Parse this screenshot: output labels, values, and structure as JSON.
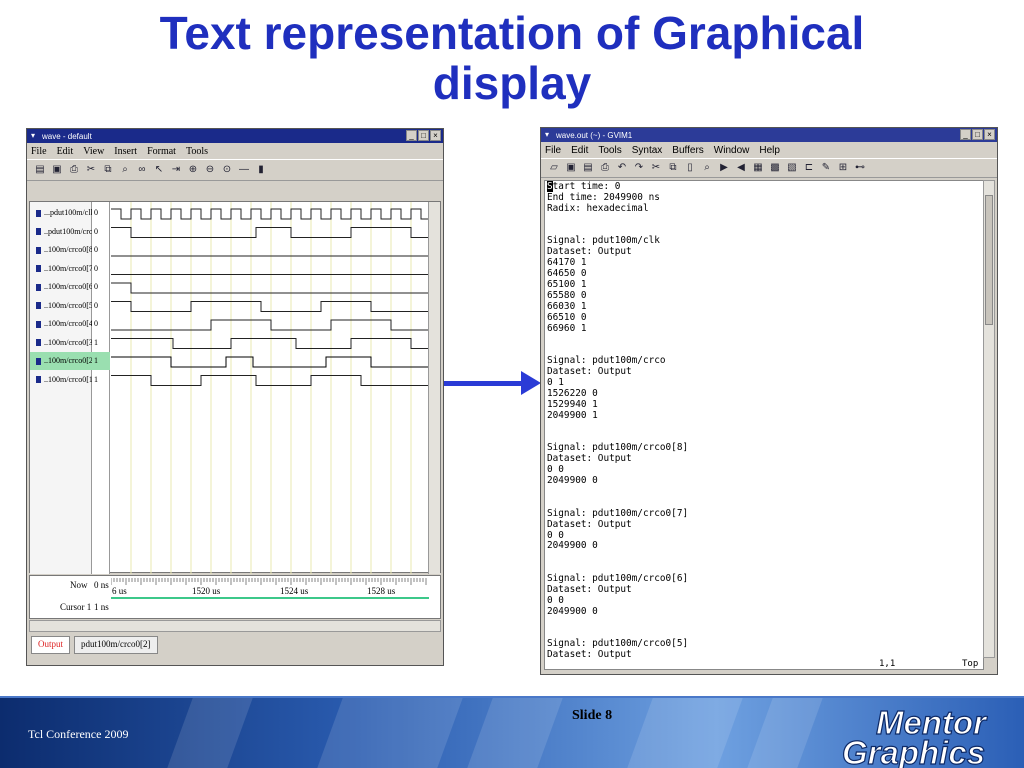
{
  "slide": {
    "title_line1": "Text representation of Graphical",
    "title_line2": "display",
    "footer_left": "Tcl Conference 2009",
    "slide_number": "Slide 8",
    "logo_line1": "Mentor",
    "logo_line2": "Graphics"
  },
  "wave_window": {
    "title": "wave - default",
    "menu": [
      "File",
      "Edit",
      "View",
      "Insert",
      "Format",
      "Tools"
    ],
    "signals": [
      {
        "name": "...pdut100m/clk",
        "value": "0"
      },
      {
        "name": "..pdut100m/crco",
        "value": "0"
      },
      {
        "name": "..100m/crco0[8]",
        "value": "0"
      },
      {
        "name": "..100m/crco0[7]",
        "value": "0"
      },
      {
        "name": "..100m/crco0[6]",
        "value": "0"
      },
      {
        "name": "..100m/crco0[5]",
        "value": "0"
      },
      {
        "name": "..100m/crco0[4]",
        "value": "0"
      },
      {
        "name": "..100m/crco0[3]",
        "value": "1"
      },
      {
        "name": "..100m/crco0[2]",
        "value": "1"
      },
      {
        "name": "..100m/crco0[1]",
        "value": "1"
      }
    ],
    "selected_index": 8,
    "now_label": "Now",
    "now_value": "0 ns",
    "cursor_label": "Cursor 1",
    "cursor_value": "1 ns",
    "timeline_ticks": [
      "6 us",
      "1520 us",
      "1524 us",
      "1528 us"
    ],
    "tabs": [
      "Output",
      "pdut100m/crco0[2]"
    ],
    "active_tab": 0,
    "accent_color": "#3cc88a"
  },
  "gvim_window": {
    "title": "wave.out (~) - GVIM1",
    "menu": [
      "File",
      "Edit",
      "Tools",
      "Syntax",
      "Buffers",
      "Window",
      "Help"
    ],
    "lines": [
      "Start time: 0",
      "End time: 2049900 ns",
      "Radix: hexadecimal",
      "",
      "",
      "Signal: pdut100m/clk",
      "Dataset: Output",
      "64170 1",
      "64650 0",
      "65100 1",
      "65580 0",
      "66030 1",
      "66510 0",
      "66960 1",
      "",
      "",
      "Signal: pdut100m/crco",
      "Dataset: Output",
      "0 1",
      "1526220 0",
      "1529940 1",
      "2049900 1",
      "",
      "",
      "Signal: pdut100m/crco0[8]",
      "Dataset: Output",
      "0 0",
      "2049900 0",
      "",
      "",
      "Signal: pdut100m/crco0[7]",
      "Dataset: Output",
      "0 0",
      "2049900 0",
      "",
      "",
      "Signal: pdut100m/crco0[6]",
      "Dataset: Output",
      "0 0",
      "2049900 0",
      "",
      "",
      "Signal: pdut100m/crco0[5]",
      "Dataset: Output"
    ],
    "status_position": "1,1",
    "status_scroll": "Top"
  }
}
